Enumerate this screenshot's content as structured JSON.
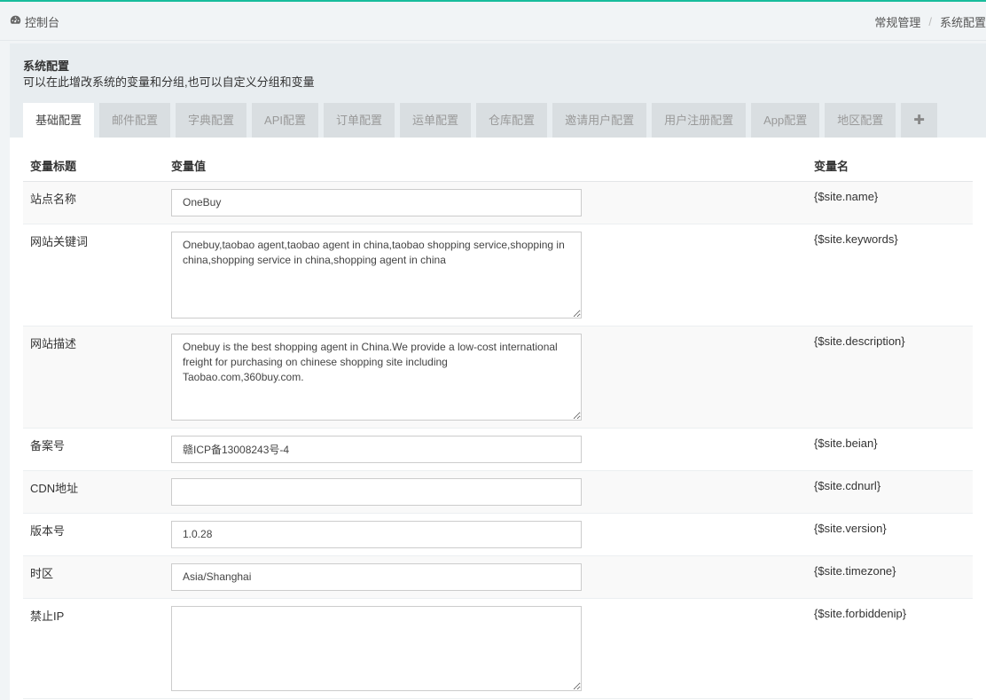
{
  "topbar": {
    "dashboard_label": "控制台",
    "breadcrumb": [
      "常规管理",
      "系统配置"
    ]
  },
  "panel": {
    "title": "系统配置",
    "description": "可以在此增改系统的变量和分组,也可以自定义分组和变量"
  },
  "tabs": [
    {
      "label": "基础配置",
      "active": true
    },
    {
      "label": "邮件配置"
    },
    {
      "label": "字典配置"
    },
    {
      "label": "API配置"
    },
    {
      "label": "订单配置"
    },
    {
      "label": "运单配置"
    },
    {
      "label": "仓库配置"
    },
    {
      "label": "邀请用户配置"
    },
    {
      "label": "用户注册配置"
    },
    {
      "label": "App配置"
    },
    {
      "label": "地区配置"
    }
  ],
  "add_tab_icon": "plus-icon",
  "table": {
    "headers": [
      "变量标题",
      "变量值",
      "变量名"
    ],
    "rows": [
      {
        "title": "站点名称",
        "type": "input",
        "value": "OneBuy",
        "name": "{$site.name}"
      },
      {
        "title": "网站关键词",
        "type": "textarea",
        "value": "Onebuy,taobao agent,taobao agent in china,taobao shopping service,shopping in china,shopping service in china,shopping agent in china",
        "name": "{$site.keywords}"
      },
      {
        "title": "网站描述",
        "type": "textarea",
        "value": "Onebuy is the best shopping agent in China.We provide a low-cost international freight for purchasing on chinese shopping site including Taobao.com,360buy.com.",
        "name": "{$site.description}"
      },
      {
        "title": "备案号",
        "type": "input",
        "value": "赣ICP备13008243号-4",
        "name": "{$site.beian}"
      },
      {
        "title": "CDN地址",
        "type": "input",
        "value": "",
        "name": "{$site.cdnurl}"
      },
      {
        "title": "版本号",
        "type": "input",
        "value": "1.0.28",
        "name": "{$site.version}"
      },
      {
        "title": "时区",
        "type": "input",
        "value": "Asia/Shanghai",
        "name": "{$site.timezone}"
      },
      {
        "title": "禁止IP",
        "type": "textarea",
        "value": "",
        "name": "{$site.forbiddenip}"
      }
    ]
  },
  "colors": {
    "accent": "#18bc9c",
    "tab_bg": "#d9dee1",
    "header_bg": "#e8edf0"
  }
}
